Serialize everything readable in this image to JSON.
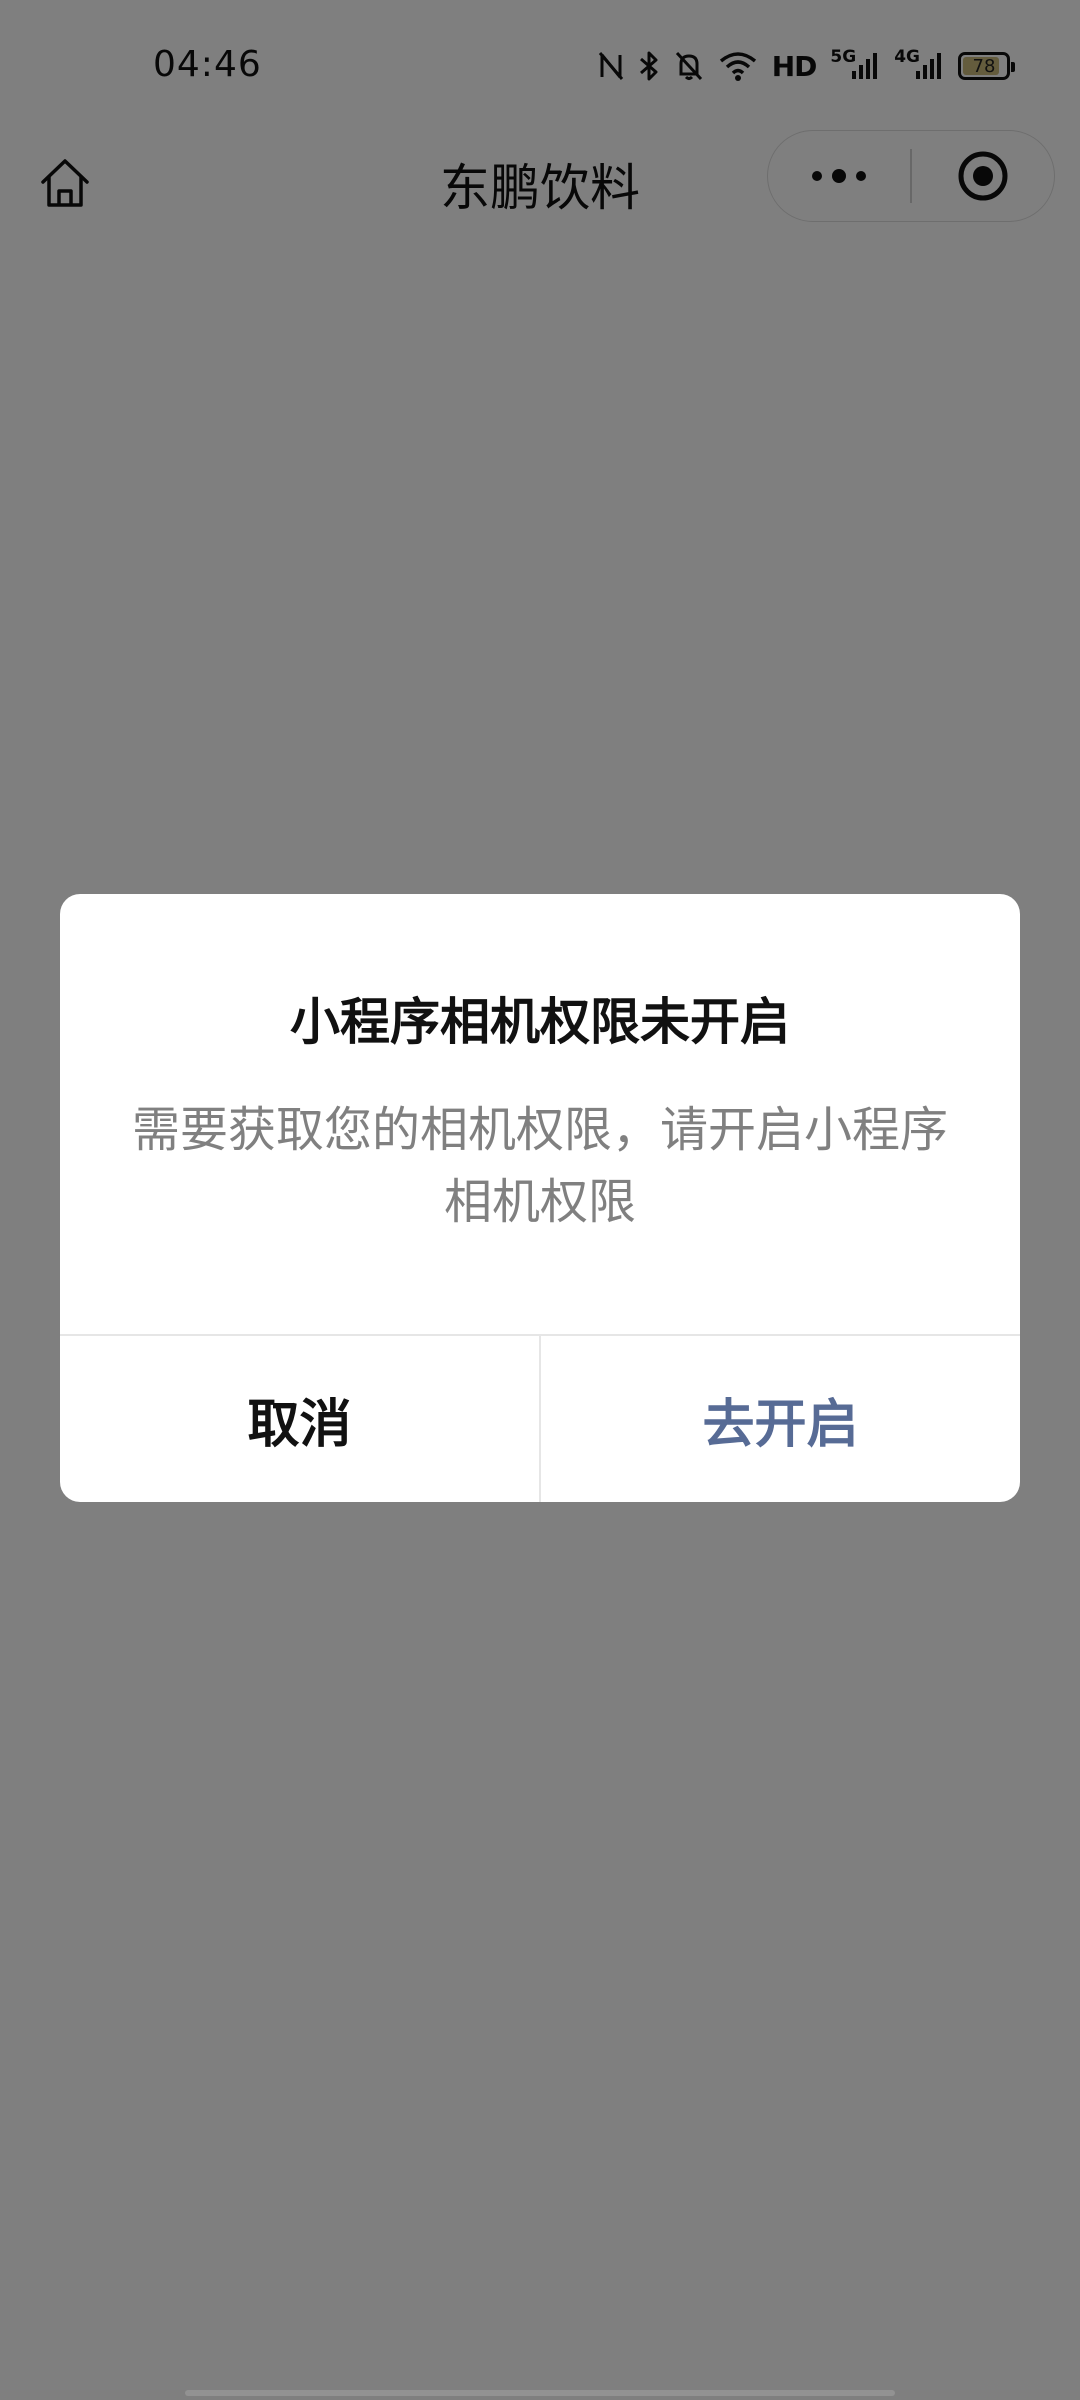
{
  "status_bar": {
    "time": "04:46",
    "hd_label": "HD",
    "net1_label": "5G",
    "net2_label": "4G",
    "battery": "78"
  },
  "nav": {
    "title": "东鹏饮料"
  },
  "dialog": {
    "title": "小程序相机权限未开启",
    "message": "需要获取您的相机权限，请开启小程序相机权限",
    "cancel_label": "取消",
    "confirm_label": "去开启"
  },
  "colors": {
    "confirm_text": "#576b95",
    "overlay": "rgba(0,0,0,0.5)",
    "battery_fill": "#c9b97a"
  }
}
